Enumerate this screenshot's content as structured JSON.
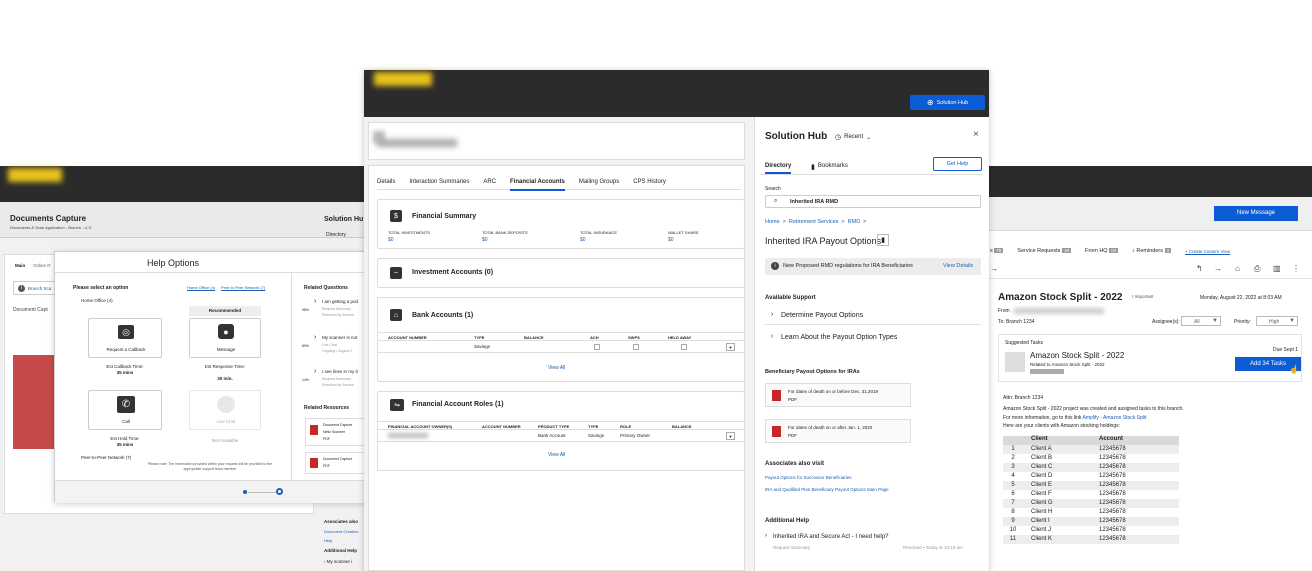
{
  "left_window": {
    "title": "Documents Capture",
    "subtitle": "Documents & Scan Application - Branch - U.S.",
    "tabs": [
      "Main",
      "Online R"
    ],
    "branch_btn": "Branch Sca",
    "doc_capture": "Document Capt",
    "solution_hub_partial": "Solution Hu",
    "directory_partial": "Directory"
  },
  "help_modal": {
    "title": "Help Options",
    "select_label": "Please select an option",
    "links": [
      "Home Office (4)",
      "Peer to Peer Network (7)"
    ],
    "home_office": "Home Office (4)",
    "recommended": "Recommended",
    "options": [
      {
        "label": "Request a Callback",
        "eta_label": "Est Callback Time:",
        "eta": "35 mins"
      },
      {
        "label": "Message",
        "eta_label": "Est Response Time:",
        "eta": "30 min."
      },
      {
        "label": "Call",
        "eta_label": "Est Hold Time:",
        "eta": "35 mins"
      },
      {
        "label": "Live Chat",
        "eta_label": "",
        "eta": "Not Available"
      }
    ],
    "peer": "Peer-to-Peer Network (7)",
    "note": "Please note: The information provided within your request will be provided to the appropriate support team member",
    "related_questions": "Related Questions",
    "questions": [
      {
        "pct": "98%",
        "text": "I am getting a pod",
        "s1": "Request Summary",
        "s2": "Resolved by Service"
      },
      {
        "pct": "89%",
        "text": "My scanner is not",
        "s1": "Live Chat",
        "s2": "Ongoing • August 2"
      },
      {
        "pct": "14%",
        "text": "I see lines in my it",
        "s1": "Request Summary",
        "s2": "Resolved by Service"
      }
    ],
    "related_resources": "Related Resources",
    "resources": [
      {
        "t1": "Document Capture",
        "t2": "Netiz Scanner",
        "t3": "PDF"
      },
      {
        "t1": "Document Capture",
        "t2": "PDF",
        "t3": ""
      }
    ]
  },
  "left_bottom": {
    "associates": "Associates also",
    "doc_link": "Document Creation",
    "help": "Help",
    "additional_help": "Additional Help",
    "scanner": "My scanner i"
  },
  "center": {
    "solution_hub_btn": "Solution Hub",
    "tabs": [
      "Details",
      "Interaction Summaries",
      "ARC",
      "Financial Accounts",
      "Mailing Groups",
      "CPS History"
    ],
    "active_tab": "Financial Accounts",
    "financial_summary": {
      "title": "Financial Summary",
      "cols": [
        {
          "label": "TOTAL INVESTMENTS",
          "value": "$0"
        },
        {
          "label": "TOTAL BANK DEPOSITS",
          "value": "$0"
        },
        {
          "label": "TOTAL INSURANCE",
          "value": "$0"
        },
        {
          "label": "WALLET SHARE",
          "value": "$0"
        }
      ]
    },
    "investment_accounts": "Investment Accounts (0)",
    "bank_accounts": {
      "title": "Bank Accounts (1)",
      "headers": [
        "ACCOUNT NUMBER",
        "TYPE",
        "BALANCE",
        "ACH",
        "SWPS",
        "HELD AWAY"
      ],
      "row_type": "Savings",
      "view_all": "View All"
    },
    "roles": {
      "title": "Financial Account Roles (1)",
      "headers": [
        "FINANCIAL ACCOUNT OWNER(S)",
        "ACCOUNT NUMBER",
        "PRODUCT TYPE",
        "TYPE",
        "ROLE",
        "BALANCE"
      ],
      "row": [
        "Bank Account",
        "Savings",
        "Primary Owner"
      ],
      "view_all": "View All"
    }
  },
  "solution_panel": {
    "title": "Solution Hub",
    "recent": "Recent",
    "tabs": [
      "Directory",
      "Bookmarks"
    ],
    "get_help": "Get Help",
    "search_label": "Search",
    "search_value": "Inherited IRA RMD",
    "breadcrumb": [
      "Home",
      "Retirement Services",
      "RMD"
    ],
    "heading": "Inherited IRA Payout Options",
    "notice": "New Proposed RMD regulations for IRA Beneficiaries",
    "notice_link": "View Details",
    "available_support": "Available Support",
    "support_items": [
      "Determine Payout Options",
      "Learn About the Payout Option Types"
    ],
    "beneficiary": "Beneficiary Payout Options for IRAs",
    "pdfs": [
      {
        "text": "For dates of death on or before Dec. 31,2019",
        "type": "PDF"
      },
      {
        "text": "For dates of death on or after Jan. 1, 2020",
        "type": "PDF"
      }
    ],
    "associates": "Associates also visit",
    "assoc_links": [
      "Payout Options for Successor Beneficiaries",
      "IRA and Qualified Plan Beneficiary Payout Options Main Page"
    ],
    "additional_help": "Additional Help",
    "help_item": "Inherited IRA and Secure Act - I need help?",
    "help_s1": "Request Summary",
    "help_s2": "Resolved • Today at 10:18 am"
  },
  "right": {
    "new_message": "New Message",
    "tabs": [
      {
        "label": "s",
        "count": "78"
      },
      {
        "label": "Service Requests",
        "count": "18"
      },
      {
        "label": "From HQ",
        "count": "04"
      },
      {
        "label": "Reminders",
        "count": "3"
      }
    ],
    "create_view": "+ Create Custom View",
    "subject": "Amazon Stock Split - 2022",
    "important": "! Important",
    "date": "Monday, August 22, 2022 at 8:03 AM",
    "from_label": "From",
    "to": "To: Branch 1234",
    "assignees_label": "Assignee(s):",
    "assignees_value": "All",
    "priority_label": "Priority:",
    "priority_value": "High",
    "suggested": "Suggested Tasks",
    "task_title": "Amazon Stock Split - 2022",
    "task_sub": "Related to Amazon Stock Split - 2022",
    "due": "Due Sept 1",
    "add_tasks": "Add 34 Tasks",
    "attn": "Attn: Branch 1234",
    "body1": "Amazon Stock Split - 2022 project was created and assigned tasks to this branch.",
    "body2_pre": "For more information, go to this link",
    "body2_link": "Amplify - Amazon Stock Split",
    "body3": "Here are your clients with Amazon stocking holdings:",
    "table_headers": [
      "Client",
      "Account"
    ],
    "rows": [
      [
        "1",
        "Client A",
        "12345678"
      ],
      [
        "2",
        "Client B",
        "12345678"
      ],
      [
        "3",
        "Client C",
        "12345678"
      ],
      [
        "4",
        "Client D",
        "12345678"
      ],
      [
        "5",
        "Client E",
        "12345678"
      ],
      [
        "6",
        "Client F",
        "12345678"
      ],
      [
        "7",
        "Client G",
        "12345678"
      ],
      [
        "8",
        "Client H",
        "12345678"
      ],
      [
        "9",
        "Client I",
        "12345678"
      ],
      [
        "10",
        "Client J",
        "12345678"
      ],
      [
        "11",
        "Client K",
        "12345678"
      ]
    ]
  }
}
